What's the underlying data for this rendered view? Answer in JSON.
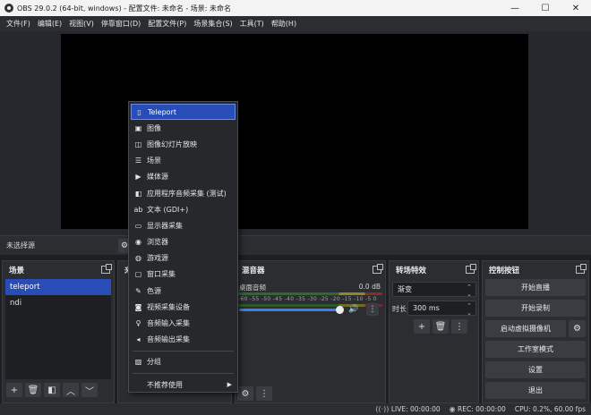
{
  "window": {
    "title": "OBS 29.0.2 (64-bit, windows) - 配置文件: 未命名 - 场景: 未命名",
    "controls": {
      "minimize": "—",
      "maximize": "☐",
      "close": "✕"
    }
  },
  "menubar": [
    "文件(F)",
    "编辑(E)",
    "视图(V)",
    "停靠窗口(D)",
    "配置文件(P)",
    "场景集合(S)",
    "工具(T)",
    "帮助(H)"
  ],
  "source_bar": {
    "no_source": "未选择源",
    "properties_glyph": "⚙"
  },
  "docks": {
    "scenes": {
      "title": "场景",
      "items": [
        "teleport",
        "ndi"
      ],
      "selected_index": 0
    },
    "sources": {
      "title": "来"
    },
    "mixer": {
      "title": "混音器",
      "channel": "桌面音频",
      "db": "0.0 dB",
      "scale": "-60 -55 -50 -45 -40 -35 -30 -25 -20 -15 -10 -5 0",
      "volume_fraction": 0.95
    },
    "transitions": {
      "title": "转场特效",
      "selected": "渐变",
      "duration_label": "时长",
      "duration_value": "300 ms"
    },
    "controls": {
      "title": "控制按钮",
      "start_stream": "开始直播",
      "start_record": "开始录制",
      "virtual_cam": "启动虚拟摄像机",
      "studio_mode": "工作室模式",
      "settings": "设置",
      "exit": "退出"
    }
  },
  "toolbar_glyphs": {
    "add": "+",
    "remove": "🗑",
    "filter": "◧",
    "up": "︿",
    "down": "﹀",
    "menu": "⋮",
    "gear": "⚙"
  },
  "status": {
    "live": "LIVE: 00:00:00",
    "rec": "REC: 00:00:00",
    "cpu": "CPU: 0.2%, 60.00 fps"
  },
  "context_menu": {
    "items": [
      {
        "label": "Teleport",
        "icon": "▯",
        "active": true
      },
      {
        "label": "图像",
        "icon": "▣"
      },
      {
        "label": "图像幻灯片放映",
        "icon": "◫"
      },
      {
        "label": "场景",
        "icon": "☰"
      },
      {
        "label": "媒体源",
        "icon": "▶"
      },
      {
        "label": "应用程序音频采集 (测试)",
        "icon": "◧"
      },
      {
        "label": "文本 (GDI+)",
        "icon": "ab"
      },
      {
        "label": "显示器采集",
        "icon": "▭"
      },
      {
        "label": "浏览器",
        "icon": "◉"
      },
      {
        "label": "游戏源",
        "icon": "◍"
      },
      {
        "label": "窗口采集",
        "icon": "▢"
      },
      {
        "label": "色源",
        "icon": "✎"
      },
      {
        "label": "视频采集设备",
        "icon": "◙"
      },
      {
        "label": "音频输入采集",
        "icon": "♀"
      },
      {
        "label": "音频输出采集",
        "icon": "◂"
      }
    ],
    "group": {
      "label": "分组",
      "icon": "▨"
    },
    "deprecated": {
      "label": "不推荐使用",
      "arrow": "▶"
    }
  }
}
